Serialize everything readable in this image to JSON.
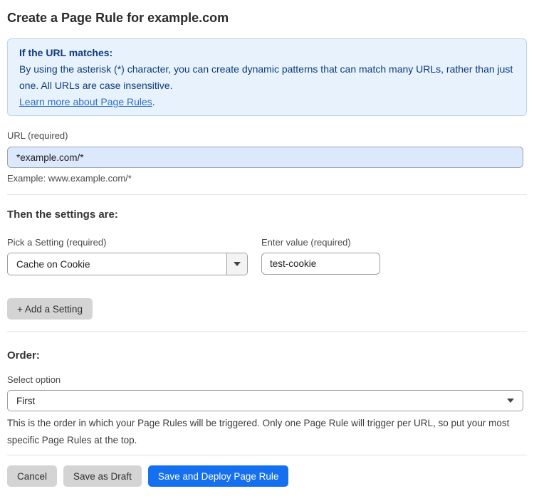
{
  "page": {
    "title": "Create a Page Rule for example.com"
  },
  "info_box": {
    "heading": "If the URL matches:",
    "body": "By using the asterisk (*) character, you can create dynamic patterns that can match many URLs, rather than just one. All URLs are case insensitive.",
    "link_label": "Learn more about Page Rules",
    "link_suffix": "."
  },
  "url_field": {
    "label": "URL (required)",
    "value": "*example.com/*",
    "example": "Example: www.example.com/*"
  },
  "settings": {
    "heading": "Then the settings are:",
    "setting_label": "Pick a Setting (required)",
    "setting_selected": "Cache on Cookie",
    "value_label": "Enter value (required)",
    "value_current": "test-cookie",
    "add_button_label": "+ Add a Setting"
  },
  "order": {
    "heading": "Order:",
    "label": "Select option",
    "selected": "First",
    "help": "This is the order in which your Page Rules will be triggered. Only one Page Rule will trigger per URL, so put your most specific Page Rules at the top."
  },
  "actions": {
    "cancel_label": "Cancel",
    "save_draft_label": "Save as Draft",
    "save_deploy_label": "Save and Deploy Page Rule"
  },
  "colors": {
    "accent_blue": "#1570ef",
    "info_background": "#e8f2fc",
    "info_border": "#b9d5f1",
    "info_text": "#0e3b7a",
    "link_blue": "#2c6ecb",
    "url_input_background": "#dce8fb",
    "button_gray": "#d4d4d4"
  }
}
